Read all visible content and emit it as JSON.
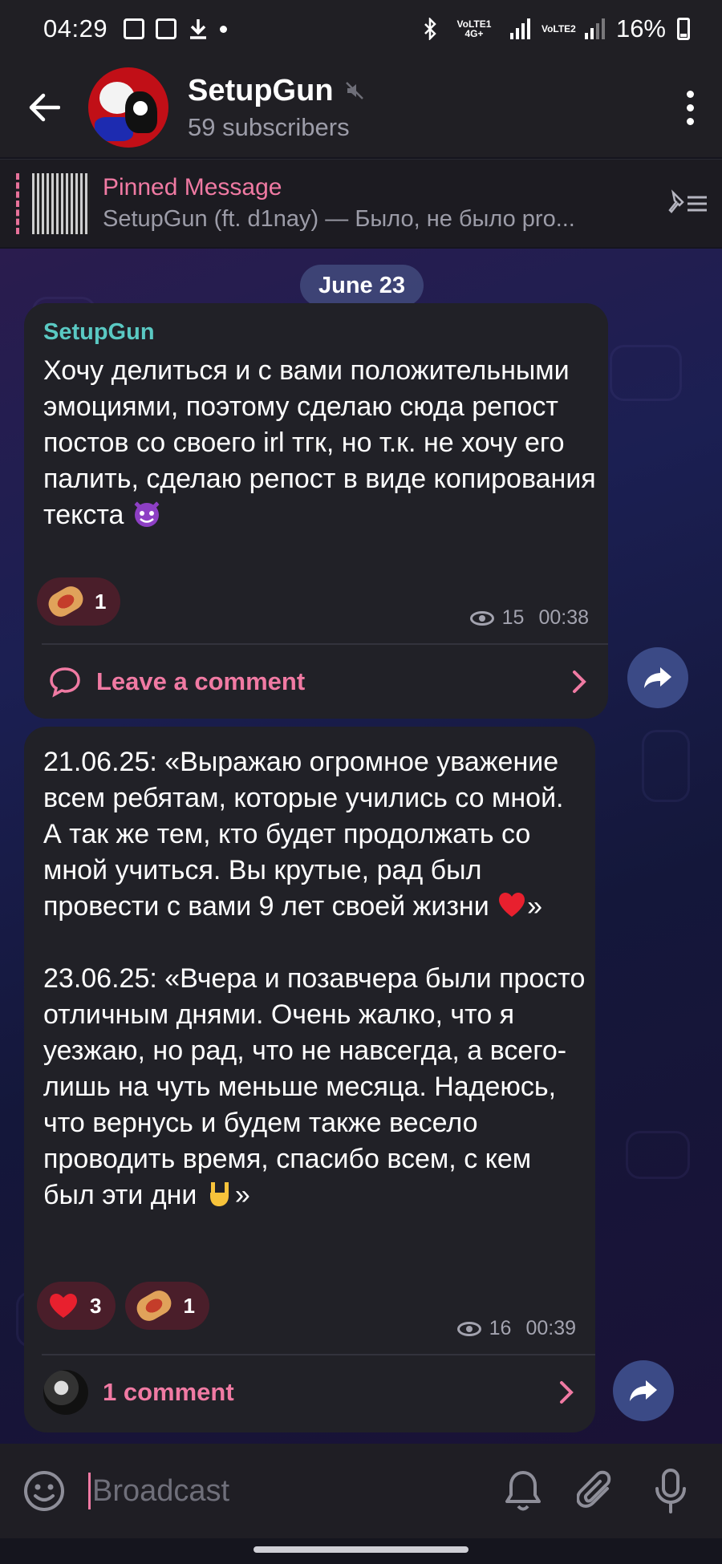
{
  "status_bar": {
    "time": "04:29",
    "network_1": "VoLTE1 4G+",
    "network_2": "VoLTE2",
    "battery": "16%"
  },
  "header": {
    "channel_name": "SetupGun",
    "subscribers": "59 subscribers"
  },
  "pinned": {
    "title": "Pinned Message",
    "preview": "SetupGun (ft. d1nay) — Было, не было  pro..."
  },
  "date_chip": "June 23",
  "messages": [
    {
      "sender": "SetupGun",
      "text": "Хочу делиться и с вами положительными эмоциями, поэтому сделаю сюда репост постов со своего irl тгк, но т.к. не хочу его палить, сделаю репост в виде копирования текста",
      "text_emoji": "smiling-imp",
      "reactions": [
        {
          "icon": "hotdog",
          "count": "1"
        }
      ],
      "views": "15",
      "time": "00:38",
      "comment_label": "Leave a comment"
    },
    {
      "text_part1": "21.06.25: «Выражаю огромное уважение всем ребятам, которые учились со мной. А так же тем, кто будет продолжать со мной учиться. Вы крутые, рад был провести с вами 9 лет своей жизни ",
      "text_part1_end": "»",
      "text_part2": "23.06.25: «Вчера и позавчера были просто отличным днями. Очень жалко, что я уезжаю, но рад, что не навсегда, а всего-лишь на чуть меньше месяца. Надеюсь, что вернусь и будем также весело проводить время, спасибо всем, с кем был эти дни ",
      "text_part2_end": "»",
      "reactions": [
        {
          "icon": "heart",
          "count": "3"
        },
        {
          "icon": "hotdog",
          "count": "1"
        }
      ],
      "views": "16",
      "time": "00:39",
      "comment_label": "1 comment"
    }
  ],
  "composer": {
    "placeholder": "Broadcast"
  },
  "colors": {
    "accent_pink": "#f07aa3",
    "sender_teal": "#5ac9c3",
    "bubble": "#212127"
  }
}
